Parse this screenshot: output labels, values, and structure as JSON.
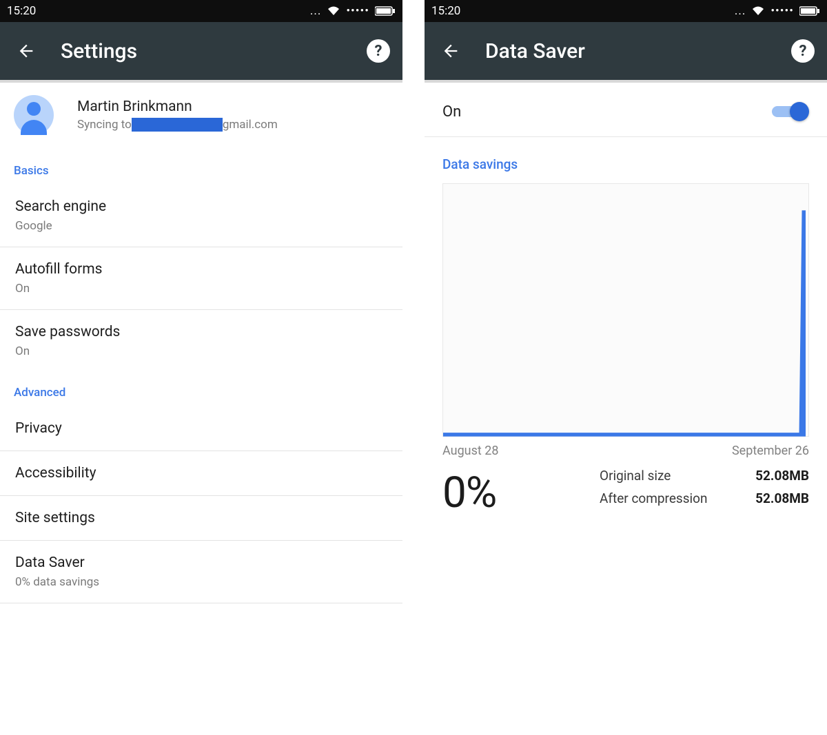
{
  "statusbar": {
    "time": "15:20",
    "dots": "...",
    "signal": "•••••"
  },
  "left": {
    "title": "Settings",
    "profile": {
      "name": "Martin Brinkmann",
      "sync_prefix": "Syncing to ",
      "sync_suffix": "gmail.com"
    },
    "sections": {
      "basics_label": "Basics",
      "advanced_label": "Advanced"
    },
    "rows": {
      "search_engine": {
        "title": "Search engine",
        "sub": "Google"
      },
      "autofill": {
        "title": "Autofill forms",
        "sub": "On"
      },
      "save_passwords": {
        "title": "Save passwords",
        "sub": "On"
      },
      "privacy": {
        "title": "Privacy"
      },
      "accessibility": {
        "title": "Accessibility"
      },
      "site_settings": {
        "title": "Site settings"
      },
      "data_saver": {
        "title": "Data Saver",
        "sub": "0% data savings"
      }
    }
  },
  "right": {
    "title": "Data Saver",
    "toggle": {
      "label": "On",
      "value": true
    },
    "section_label": "Data savings",
    "chart": {
      "date_start": "August 28",
      "date_end": "September 26"
    },
    "stats": {
      "percent": "0%",
      "original_label": "Original size",
      "original_value": "52.08MB",
      "after_label": "After compression",
      "after_value": "52.08MB"
    }
  },
  "chart_data": {
    "type": "area",
    "title": "Data savings",
    "xlabel": "",
    "ylabel": "",
    "x_range": [
      "August 28",
      "September 26"
    ],
    "series": [
      {
        "name": "Data savings",
        "values_estimate": "flat near 0 for ~29 days, sharp spike on final day"
      }
    ],
    "summary": {
      "percent_saved": 0,
      "original_size_mb": 52.08,
      "after_compression_mb": 52.08
    }
  }
}
